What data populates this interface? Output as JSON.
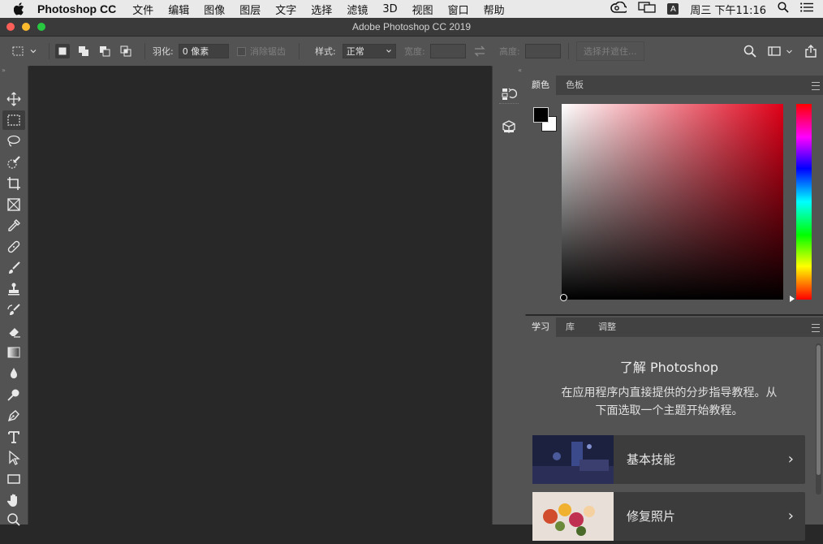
{
  "menubar": {
    "app_name": "Photoshop CC",
    "items": [
      "文件",
      "编辑",
      "图像",
      "图层",
      "文字",
      "选择",
      "滤镜",
      "3D",
      "视图",
      "窗口",
      "帮助"
    ],
    "badge": "A",
    "clock": "周三 下午11:16"
  },
  "window": {
    "title": "Adobe Photoshop CC 2019"
  },
  "options": {
    "feather_label": "羽化:",
    "feather_value": "0 像素",
    "antialias_label": "消除锯齿",
    "style_label": "样式:",
    "style_value": "正常",
    "width_label": "宽度:",
    "height_label": "高度:",
    "select_mask_label": "选择并遮住..."
  },
  "color_panel": {
    "tabs": [
      "颜色",
      "色板"
    ],
    "foreground": "#000000",
    "background": "#ffffff",
    "hue_color": "#e00018"
  },
  "learn_panel": {
    "tabs": [
      "学习",
      "库",
      "调整"
    ],
    "title": "了解 Photoshop",
    "desc_line1": "在应用程序内直接提供的分步指导教程。从",
    "desc_line2": "下面选取一个主题开始教程。",
    "cards": [
      {
        "label": "基本技能",
        "chevron": "›"
      },
      {
        "label": "修复照片",
        "chevron": "›"
      }
    ]
  },
  "icons": {
    "toolbar": [
      "move-icon",
      "marquee-icon",
      "lasso-icon",
      "quick-select-icon",
      "crop-icon",
      "frame-icon",
      "eyedropper-icon",
      "healing-icon",
      "brush-icon",
      "stamp-icon",
      "history-brush-icon",
      "eraser-icon",
      "gradient-icon",
      "blur-icon",
      "dodge-icon",
      "pen-icon",
      "type-icon",
      "path-select-icon",
      "rectangle-icon",
      "hand-icon",
      "zoom-icon"
    ]
  },
  "colors": {
    "menubar_bg": "#e9e9e9",
    "titlebar_bg": "#3a3a3a",
    "chrome_bg": "#535353",
    "canvas_bg": "#282828",
    "traffic_red": "#fc5f57",
    "traffic_yellow": "#fdbc2e",
    "traffic_green": "#28c840"
  }
}
